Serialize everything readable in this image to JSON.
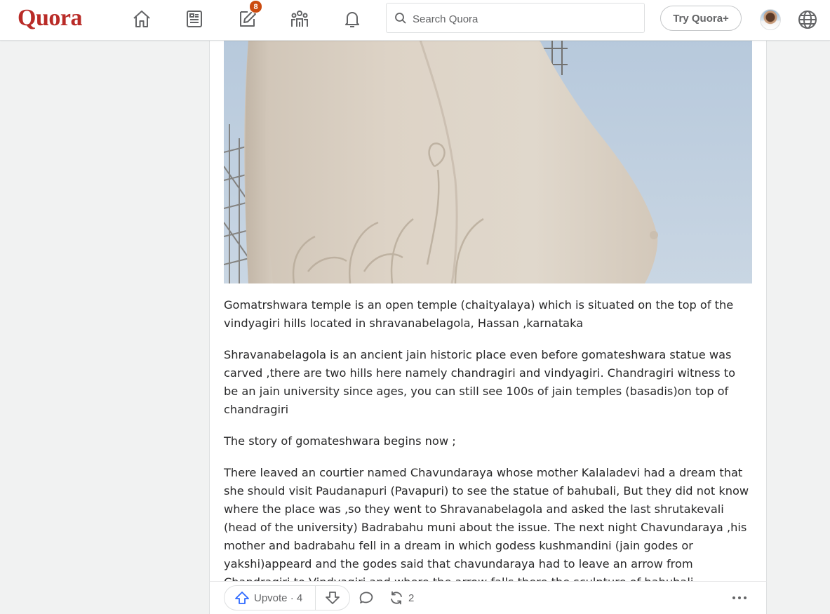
{
  "brand": {
    "logo_text": "Quora",
    "color": "#b92b27"
  },
  "nav": {
    "items": [
      {
        "name": "home",
        "icon": "home-icon"
      },
      {
        "name": "following",
        "icon": "following-icon"
      },
      {
        "name": "answer",
        "icon": "answer-icon",
        "badge": "8"
      },
      {
        "name": "spaces",
        "icon": "spaces-icon"
      },
      {
        "name": "notifications",
        "icon": "bell-icon"
      }
    ]
  },
  "search": {
    "placeholder": "Search Quora",
    "value": ""
  },
  "try_button": {
    "label": "Try Quora+"
  },
  "answer": {
    "image_icon": "statue-photo",
    "paragraphs": [
      "Gomatrshwara temple is an open temple (chaityalaya) which is situated on the top of the vindyagiri hills located in shravanabelagola, Hassan ,karnataka",
      "Shravanabelagola is an ancient jain historic place even before gomateshwara statue was carved ,there are two hills here namely chandragiri and vindyagiri. Chandragiri witness to be an jain university since ages, you can still see 100s of jain temples (basadis)on top of chandragiri",
      "The story of gomateshwara begins now ;",
      "There leaved an courtier named Chavundaraya whose mother Kalaladevi had a dream that she should visit Paudanapuri (Pavapuri) to see the statue of bahubali, But they did not know where the place was ,so they went to Shravanabelagola and asked the last shrutakevali (head of the university) Badrabahu muni about the issue. The next night Chavundaraya ,his mother and badrabahu fell in a dream in which godess kushmandini (jain godes or yakshi)appeard and the godes said that chavundaraya had to leave an arrow from Chandragiri to Vindyagiri and where the arrow falls there the sculpture of bahubali"
    ]
  },
  "actions": {
    "upvote_label": "Upvote · 4",
    "share_count": "2"
  },
  "colors": {
    "accent": "#2e69ff",
    "muted": "#636466",
    "badge": "#cb4b10"
  }
}
